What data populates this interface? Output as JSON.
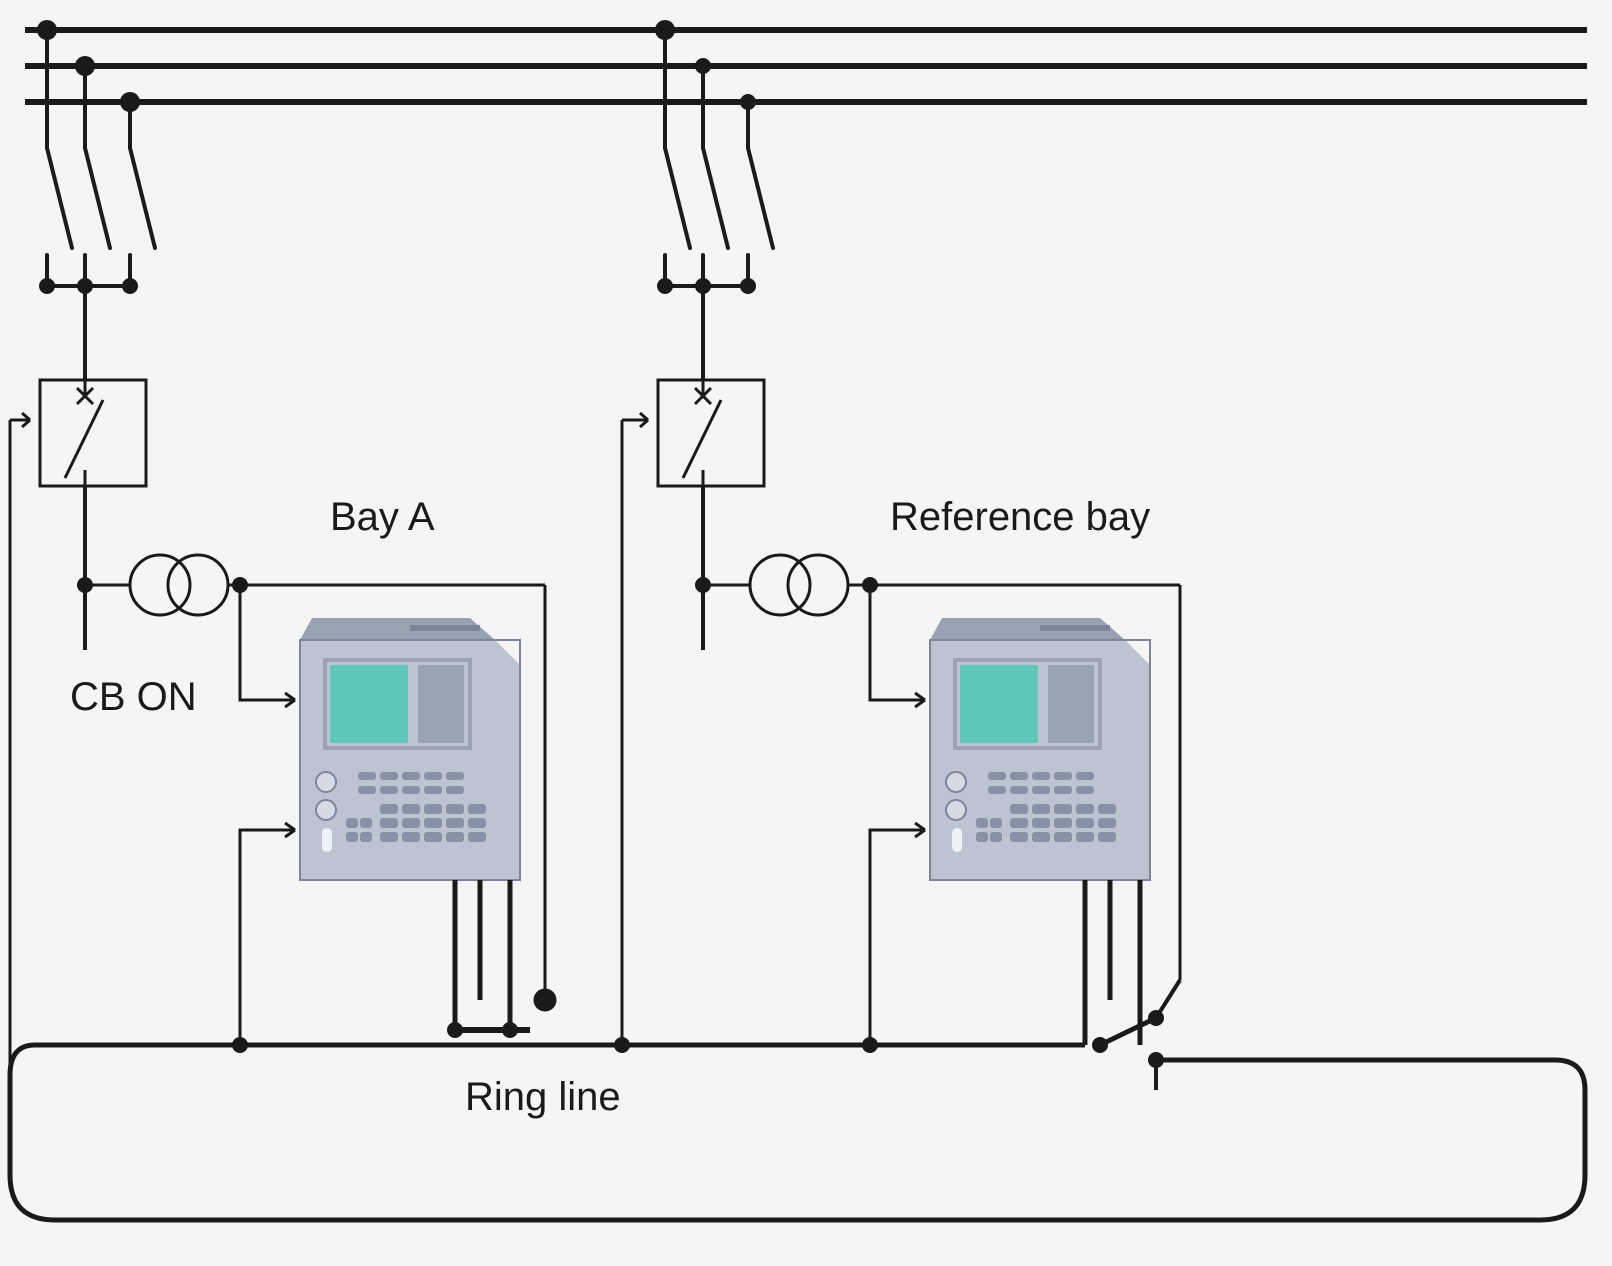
{
  "labels": {
    "bay_a": "Bay A",
    "reference_bay": "Reference bay",
    "cb_on": "CB ON",
    "ring_line": "Ring line"
  },
  "colors": {
    "line": "#1a1a1a",
    "device_body": "#bcc4d1",
    "device_body_dark": "#99a2b3",
    "device_screen": "#5fc8bb",
    "device_fill": "#d5dae3",
    "background": "#f4f5f4"
  }
}
